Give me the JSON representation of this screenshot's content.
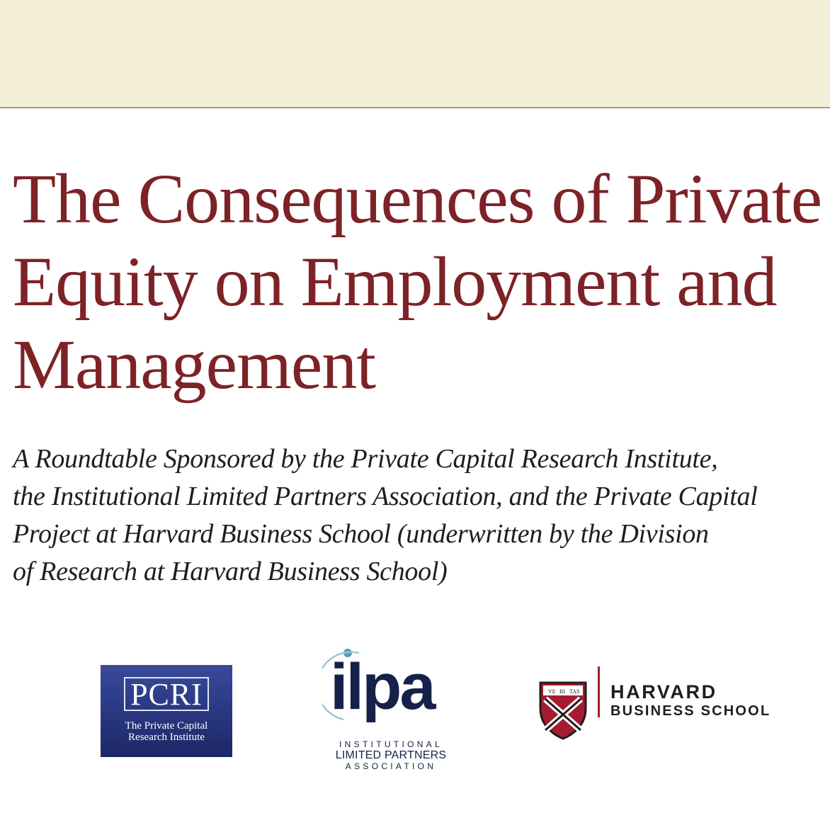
{
  "title_lines": [
    "The Consequences of Private",
    "Equity on Employment and",
    "Management"
  ],
  "subtitle_lines": [
    "A Roundtable Sponsored by the Private Capital Research Institute,",
    "the Institutional Limited Partners Association, and the Private Capital",
    "Project at Harvard Business School (underwritten by the Division",
    "of Research at Harvard Business School)"
  ],
  "colors": {
    "title": "#7d2226",
    "top_band": "#f3efd8",
    "pcri_blue": "#2b3a86",
    "ilpa_navy": "#16214a",
    "harvard_crimson": "#a51c30"
  },
  "logos": {
    "pcri": {
      "mark": "PCRI",
      "name_line1": "The Private Capital",
      "name_line2": "Research Institute"
    },
    "ilpa": {
      "wordmark": "ilpa",
      "tag_line1": "INSTITUTIONAL",
      "tag_line2": "LIMITED PARTNERS",
      "tag_line3": "ASSOCIATION"
    },
    "harvard": {
      "line1": "HARVARD",
      "line2": "BUSINESS SCHOOL",
      "shield_motto": [
        "VE",
        "RI",
        "TAS"
      ]
    }
  }
}
